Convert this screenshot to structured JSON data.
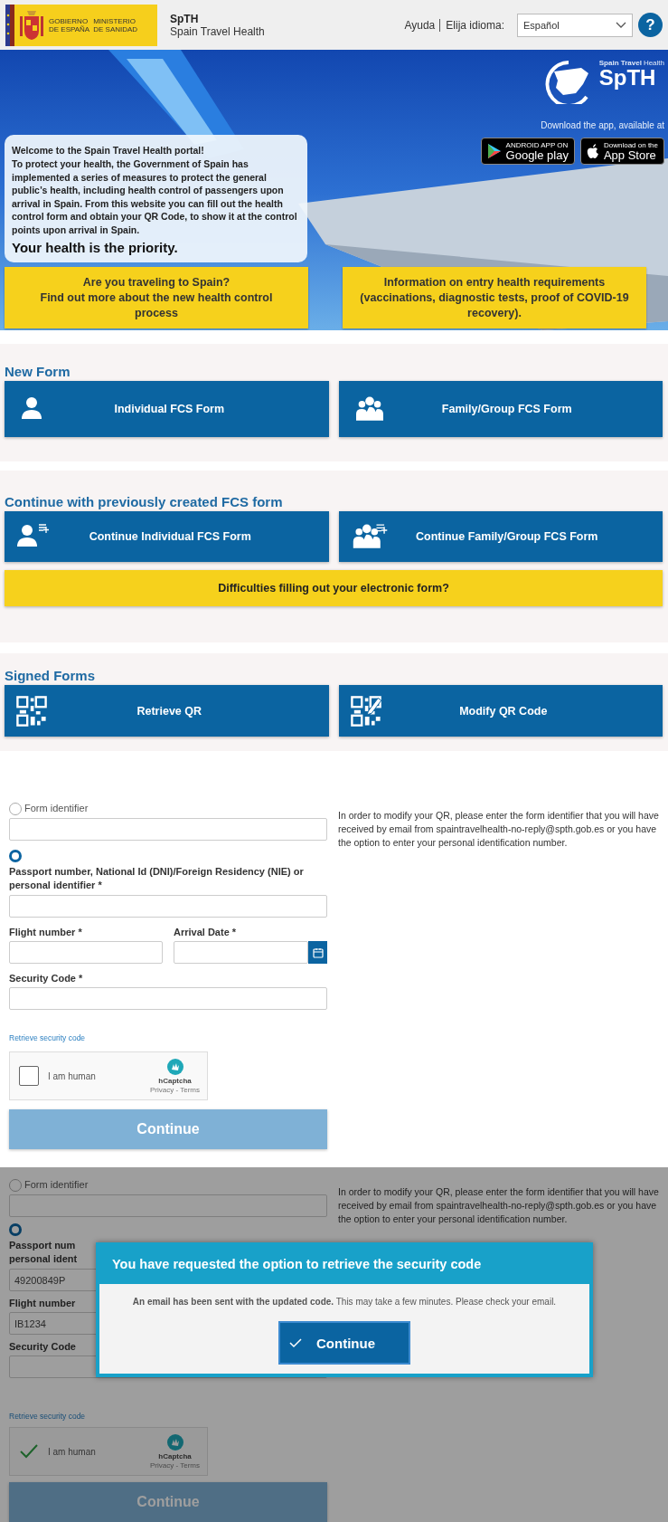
{
  "header": {
    "gov_logo": {
      "government": "GOBIERNO\nDE ESPAÑA",
      "ministry": "MINISTERIO\nDE SANIDAD"
    },
    "app_name": "SpTH",
    "app_subtitle": "Spain Travel Health",
    "help_link": "Ayuda",
    "language_label": "Elija idioma:",
    "language_select": {
      "value": "Español"
    },
    "help_button": "?"
  },
  "hero": {
    "welcome_title": "Welcome to the Spain Travel Health portal!",
    "welcome_text": "To protect your health, the Government of Spain has implemented a series of measures to protect the general public’s health, including health control of passengers upon arrival in Spain. From this website you can fill out the health control form and obtain your QR Code, to show it at the control points upon arrival in Spain.",
    "tagline": "Your health is the priority.",
    "logo": {
      "small_text": "Spain Travel",
      "small_text_cut": "Health",
      "mark": "SpTH"
    },
    "download_text": "Download the app, available at",
    "stores": [
      {
        "kind": "google",
        "caption": "ANDROID APP ON",
        "name": "Google play"
      },
      {
        "kind": "apple",
        "caption": "Download on the",
        "name": "App Store"
      }
    ],
    "info_buttons": [
      "Are you traveling to Spain?\nFind out more about the new health control process",
      "Information on entry health requirements (vaccinations, diagnostic tests, proof of COVID-19 recovery)."
    ]
  },
  "sections": [
    {
      "title": "New Form",
      "buttons": [
        {
          "kind": "person",
          "label": "Individual FCS Form"
        },
        {
          "kind": "group",
          "label": "Family/Group FCS Form"
        }
      ]
    },
    {
      "title": "Continue with previously created FCS form",
      "buttons": [
        {
          "kind": "person-add",
          "label": "Continue Individual FCS Form"
        },
        {
          "kind": "group-add",
          "label": "Continue Family/Group FCS Form"
        }
      ],
      "notice": "Difficulties filling out your electronic form?"
    },
    {
      "title": "Signed Forms",
      "buttons": [
        {
          "kind": "qr",
          "label": "Retrieve QR"
        },
        {
          "kind": "qr-edit",
          "label": "Modify QR Code"
        }
      ]
    }
  ],
  "forms": [
    {
      "dimmed": false,
      "help_text": "In order to modify your QR, please enter the form identifier that you will have received by email from spaintravelhealth-no-reply@spth.gob.es or you have the option to enter your personal identification number.",
      "rows": [
        {
          "kind": "radio",
          "label": "Form identifier",
          "selected": false
        },
        {
          "kind": "radio",
          "label": "Passport number, National Id (DNI)/Foreign Residency (NIE) or personal identifier *",
          "selected": true
        },
        {
          "kind": "pair",
          "fields": [
            {
              "kind": "text",
              "label": "Flight number *"
            },
            {
              "kind": "date",
              "label": "Arrival Date *"
            }
          ]
        },
        {
          "kind": "field",
          "label": "Security Code *"
        },
        {
          "kind": "link",
          "text": "Retrieve security code"
        },
        {
          "kind": "captcha",
          "label": "I am human",
          "checked": false,
          "brand": "hCaptcha",
          "footer": "Privacy - Terms"
        },
        {
          "kind": "submit",
          "label": "Continue",
          "disabled": true
        }
      ]
    },
    {
      "dimmed": true,
      "help_text": "In order to modify your QR, please enter the form identifier that you will have received by email from spaintravelhealth-no-reply@spth.gob.es or you have the option to enter your personal identification number.",
      "rows": [
        {
          "kind": "radio",
          "label": "Form identifier",
          "selected": false
        },
        {
          "kind": "radio",
          "label": "Passport num\npersonal ident",
          "selected": true,
          "value": "49200849P"
        },
        {
          "kind": "pair",
          "fields": [
            {
              "kind": "text",
              "label": "Flight number",
              "value": "IB1234"
            }
          ]
        },
        {
          "kind": "field",
          "label": "Security Code"
        },
        {
          "kind": "link",
          "text": "Retrieve security code"
        },
        {
          "kind": "captcha",
          "label": "I am human",
          "checked": true,
          "brand": "hCaptcha",
          "footer": "Privacy - Terms"
        },
        {
          "kind": "submit",
          "label": "Continue",
          "disabled": true
        }
      ],
      "modal": {
        "title": "You have requested the option to retrieve the security code",
        "message": "**An email has been sent with the updated code.** This may take a few minutes. Please check your email.",
        "button": "Continue"
      }
    }
  ]
}
